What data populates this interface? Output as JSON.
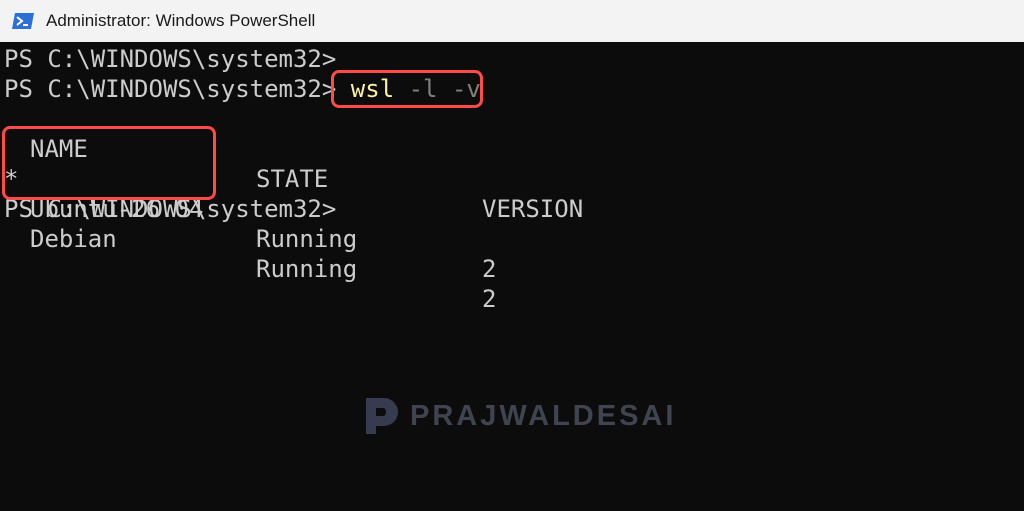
{
  "window": {
    "title": "Administrator: Windows PowerShell",
    "icon": "powershell-icon"
  },
  "console": {
    "prompt": "PS C:\\WINDOWS\\system32>",
    "command": {
      "name": "wsl",
      "args": "-l -v"
    },
    "table": {
      "headers": [
        "NAME",
        "STATE",
        "VERSION"
      ],
      "rows": [
        {
          "default_marker": "*",
          "name": "Ubuntu-26.04",
          "state": "Running",
          "version": "2"
        },
        {
          "default_marker": "",
          "name": "Debian",
          "state": "Running",
          "version": "2"
        }
      ]
    }
  },
  "watermark": {
    "text": "PRAJWALDESAI",
    "logo": "p-logo-icon"
  },
  "colors": {
    "background": "#0c0c0c",
    "text": "#cccccc",
    "command_yellow": "#f9f1a5",
    "args_gray": "#808080",
    "highlight_red": "#ff4a4a",
    "titlebar": "#f3f3f3"
  }
}
